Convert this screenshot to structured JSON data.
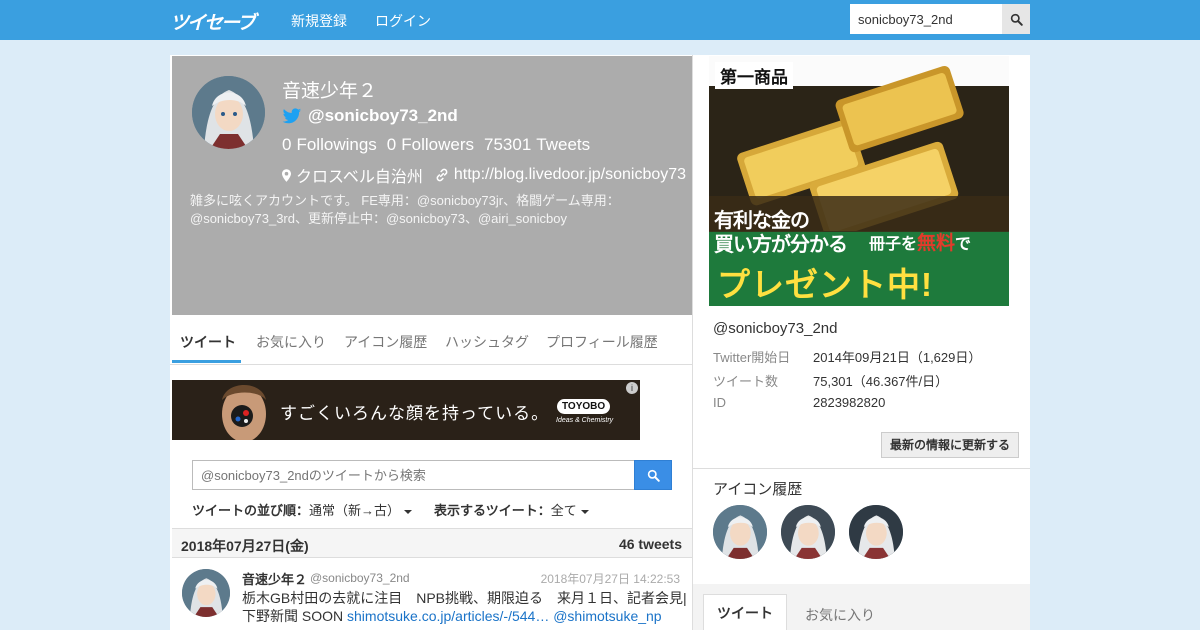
{
  "nav": {
    "logo": "ツイセーブ",
    "signup": "新規登録",
    "login": "ログイン",
    "search_value": "sonicboy73_2nd"
  },
  "profile": {
    "name": "音速少年２",
    "screen_name": "@sonicboy73_2nd",
    "followings_count": "0",
    "followings_label": "Followings",
    "followers_count": "0",
    "followers_label": "Followers",
    "tweets_count": "75301",
    "tweets_label": "Tweets",
    "location": "クロスベル自治州",
    "url": "http://blog.livedoor.jp/sonicboy73",
    "description": "雑多に呟くアカウントです。 FE専用：@sonicboy73jr、格闘ゲーム専用：@sonicboy73_3rd、更新停止中：@sonicboy73、@airi_sonicboy"
  },
  "tabs": [
    "ツイート",
    "お気に入り",
    "アイコン履歴",
    "ハッシュタグ",
    "プロフィール履歴"
  ],
  "ad_banner": {
    "text": "すごくいろんな顔を持っている。",
    "brand": "TOYOBO",
    "tagline": "Ideas & Chemistry",
    "info": "i"
  },
  "tweet_search": {
    "placeholder": "@sonicboy73_2ndのツイートから検索"
  },
  "sort": {
    "order_label": "ツイートの並び順：",
    "order_value": "通常（新→古）",
    "filter_label": "表示するツイート：",
    "filter_value": "全て"
  },
  "day": {
    "date": "2018年07月27日(金)",
    "count": "46 tweets"
  },
  "tweet": {
    "name": "音速少年２",
    "screen_name": "@sonicboy73_2nd",
    "time": "2018年07月27日 14:22:53",
    "text": "栃木GB村田の去就に注目　NPB挑戦、期限迫る　来月１日、記者会見|下野新聞 SOON ",
    "link": "shimotsuke.co.jp/articles/-/544…",
    "mention": "@shimotsuke_np"
  },
  "side_ad": {
    "company": "第一商品",
    "line1": "有利な金の",
    "line2": "買い方が分かる",
    "line3_a": "冊子を",
    "line3_b": "無料",
    "line3_c": "で",
    "line4": "プレゼント中!"
  },
  "side": {
    "handle": "@sonicboy73_2nd",
    "rows": [
      {
        "k": "Twitter開始日",
        "v": "2014年09月21日（1,629日）"
      },
      {
        "k": "ツイート数",
        "v": "75,301（46.367件/日）"
      },
      {
        "k": "ID",
        "v": "2823982820"
      }
    ],
    "update_button": "最新の情報に更新する",
    "icons_title": "アイコン履歴",
    "tab_tweet": "ツイート",
    "tab_fav": "お気に入り"
  },
  "colors": {
    "navbar": "#3a9fe0",
    "profile_bg": "#acacac",
    "link": "#1a73c8",
    "accent": "#3a8ee6"
  }
}
